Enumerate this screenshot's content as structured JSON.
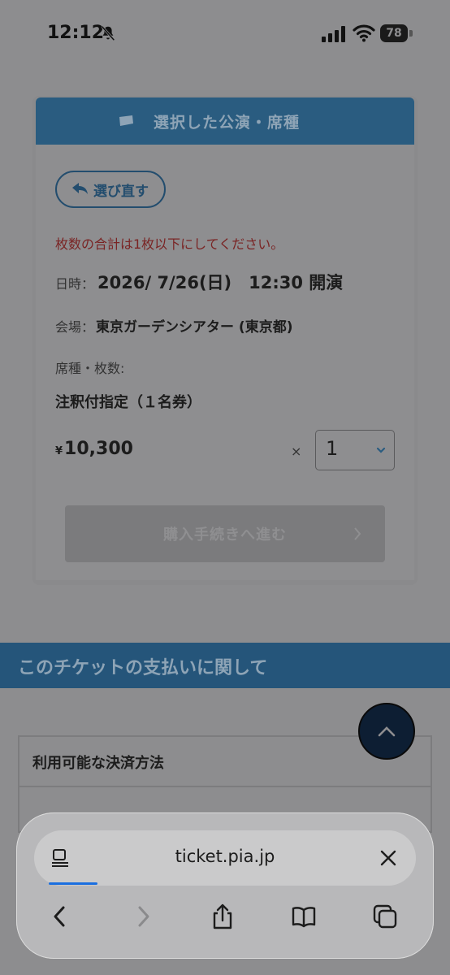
{
  "status_bar": {
    "time": "12:12",
    "battery": "78",
    "icons": [
      "bell-slash-icon",
      "signal-icon",
      "wifi-icon",
      "battery-icon"
    ]
  },
  "card": {
    "header_title": "選択した公演・席種",
    "reselect_label": "選び直す",
    "error_message": "枚数の合計は1枚以下にしてください。",
    "datetime_label": "日時：",
    "datetime_value": "2026/ 7/26(日)　12:30 開演",
    "venue_label": "会場：",
    "venue_value": "東京ガーデンシアター (東京都)",
    "seat_label": "席種・枚数:",
    "seat_type": "注釈付指定（１名券）",
    "currency": "¥",
    "price": "10,300",
    "times_symbol": "×",
    "quantity": "1",
    "purchase_label": "購入手続きへ進む"
  },
  "section": {
    "title": "このチケットの支払いに関して",
    "payment_label": "利用可能な決済方法"
  },
  "browser": {
    "url": "ticket.pia.jp",
    "accent": "#1a6fe0"
  }
}
